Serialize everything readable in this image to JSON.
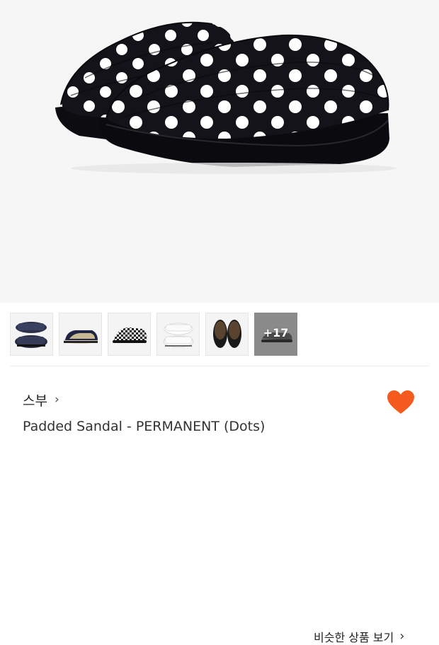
{
  "hero": {
    "image": "polka-dot-padded-sandals"
  },
  "thumbnails": [
    {
      "name": "navy-slippers"
    },
    {
      "name": "beige-navy-slide"
    },
    {
      "name": "checkered-slipper"
    },
    {
      "name": "white-slippers"
    },
    {
      "name": "brown-slippers"
    }
  ],
  "more_thumbnails": {
    "label": "+17"
  },
  "similar": {
    "label": "비슷한 상품 보기",
    "chevron": "›"
  },
  "brand": {
    "name": "스부",
    "chevron": "›"
  },
  "product": {
    "title": "Padded Sandal - PERMANENT (Dots)"
  },
  "wishlist": {
    "icon": "heart-icon",
    "color": "#f55a1e"
  }
}
